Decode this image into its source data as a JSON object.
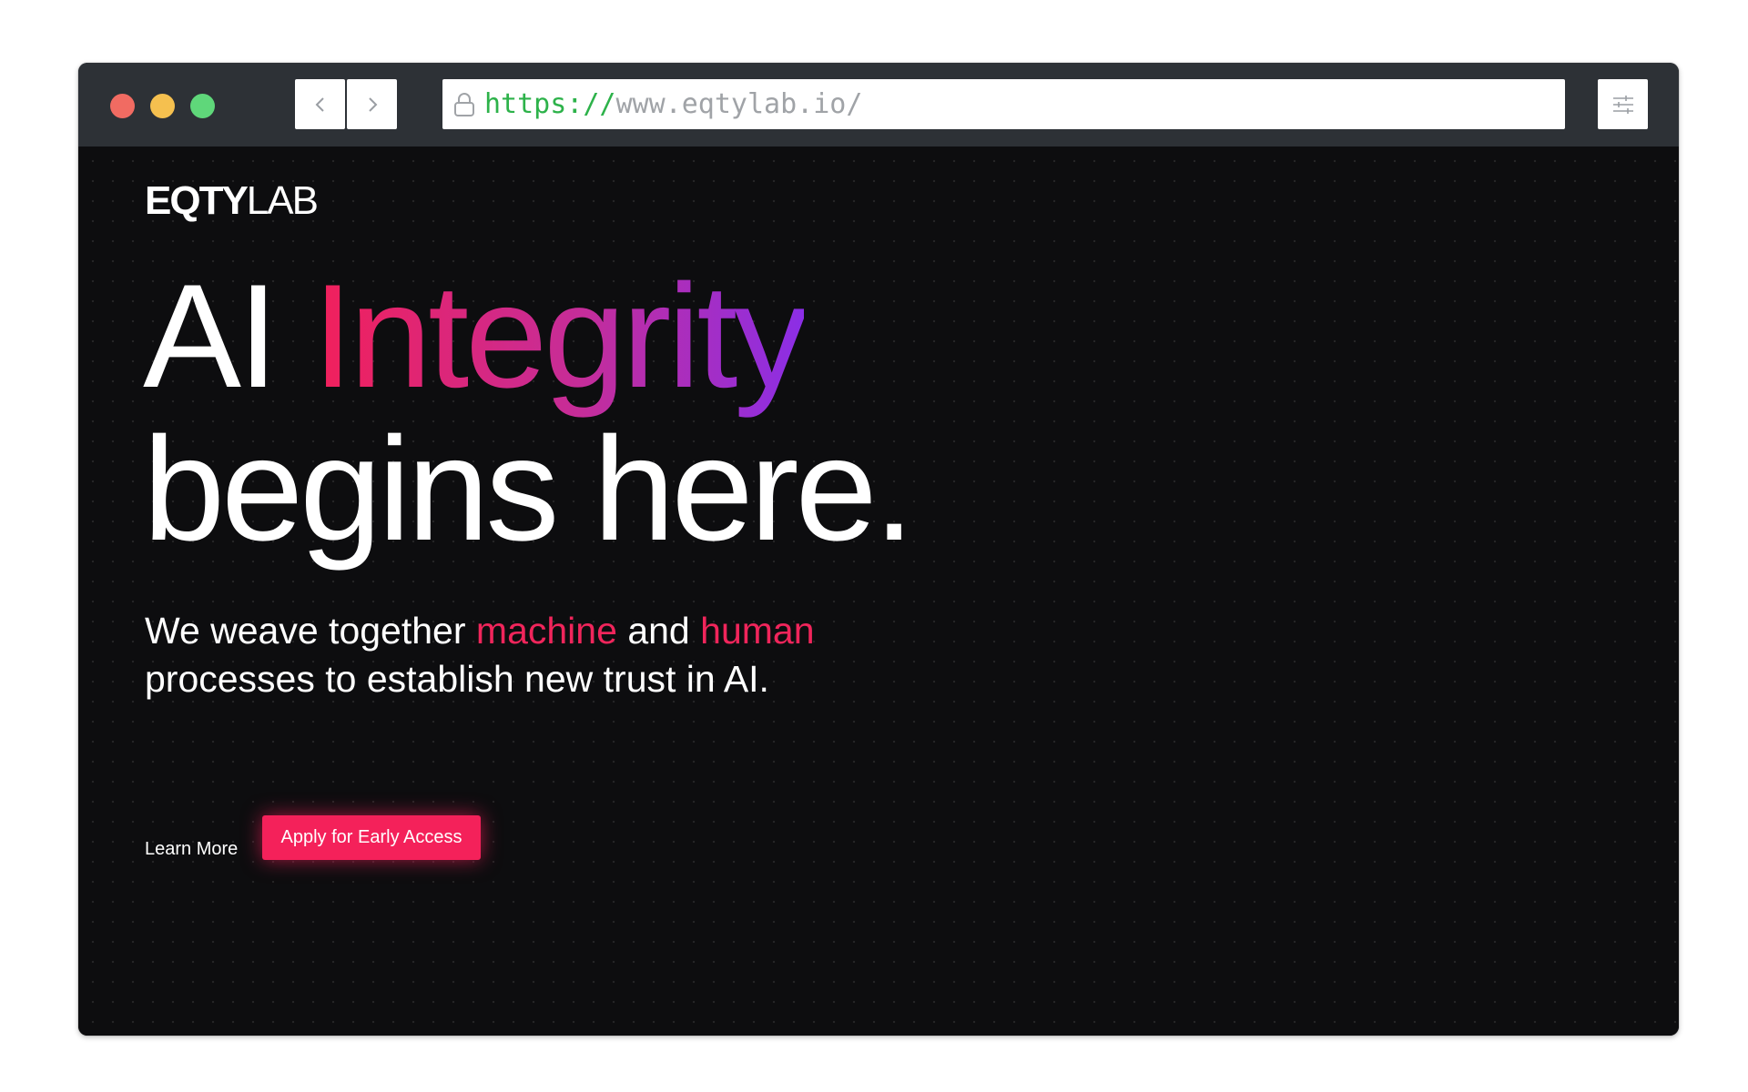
{
  "browser": {
    "url_scheme": "https://",
    "url_host": "www.eqtylab.io/"
  },
  "site": {
    "logo_bold": "EQTY",
    "logo_light": "LAB"
  },
  "hero": {
    "headline_word1": "AI",
    "headline_word2": "Integrity",
    "headline_line2": "begins here.",
    "subtitle_part1": "We weave together",
    "subtitle_accent1": "machine",
    "subtitle_and": "and",
    "subtitle_accent2": "human",
    "subtitle_line2": "processes to establish new trust in AI.",
    "learn_more_label": "Learn More",
    "apply_label": "Apply for Early Access"
  },
  "colors": {
    "accent": "#f4215a",
    "gradient_start": "#f2205a",
    "gradient_end": "#8b2ee6",
    "background": "#0d0d0f",
    "titlebar": "#2d3136"
  }
}
